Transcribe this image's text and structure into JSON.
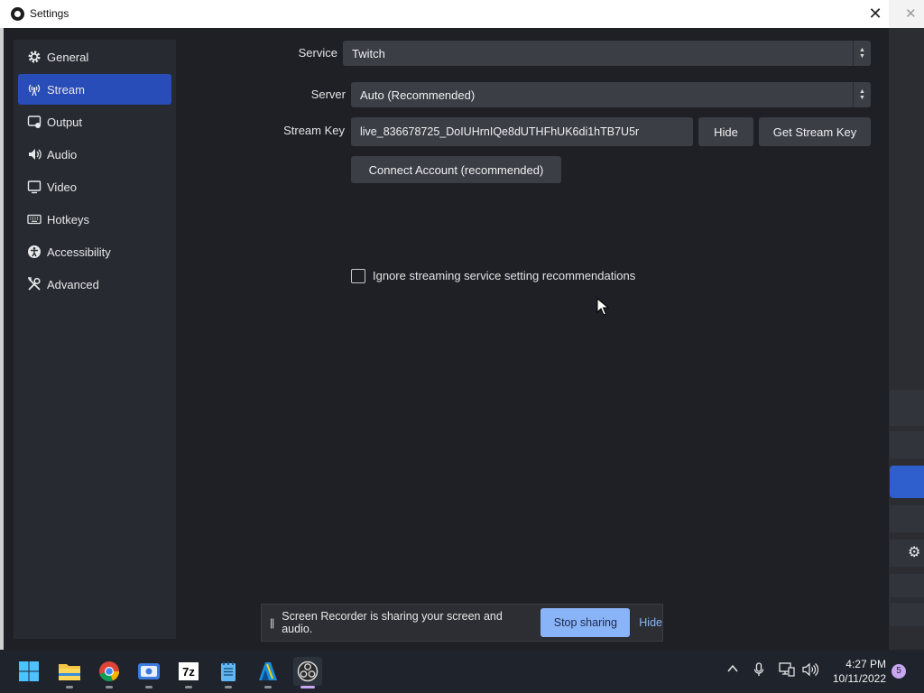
{
  "window": {
    "title": "Settings",
    "close_glyph": "✕"
  },
  "sidebar": {
    "items": [
      {
        "label": "General",
        "icon": "gear-icon",
        "active": false
      },
      {
        "label": "Stream",
        "icon": "antenna-icon",
        "active": true
      },
      {
        "label": "Output",
        "icon": "output-icon",
        "active": false
      },
      {
        "label": "Audio",
        "icon": "speaker-icon",
        "active": false
      },
      {
        "label": "Video",
        "icon": "monitor-icon",
        "active": false
      },
      {
        "label": "Hotkeys",
        "icon": "keyboard-icon",
        "active": false
      },
      {
        "label": "Accessibility",
        "icon": "accessibility-icon",
        "active": false
      },
      {
        "label": "Advanced",
        "icon": "tools-icon",
        "active": false
      }
    ]
  },
  "stream": {
    "service_label": "Service",
    "service_value": "Twitch",
    "server_label": "Server",
    "server_value": "Auto (Recommended)",
    "stream_key_label": "Stream Key",
    "stream_key_value": "live_836678725_DoIUHrnIQe8dUTHFhUK6di1hTB7U5r",
    "hide_button": "Hide",
    "get_key_button": "Get Stream Key",
    "connect_button": "Connect Account (recommended)",
    "ignore_checkbox_label": "Ignore streaming service setting recommendations",
    "ignore_checked": false
  },
  "share_bar": {
    "pause_glyph": "||",
    "message": "Screen Recorder is sharing your screen and audio.",
    "stop_button": "Stop sharing",
    "hide_link": "Hide"
  },
  "taskbar": {
    "apps": [
      {
        "name": "start-icon"
      },
      {
        "name": "file-explorer-icon"
      },
      {
        "name": "chrome-icon"
      },
      {
        "name": "screen-recorder-icon"
      },
      {
        "name": "7zip-icon",
        "text": "7z"
      },
      {
        "name": "notepad-icon"
      },
      {
        "name": "vlc-icon"
      },
      {
        "name": "obs-icon",
        "active": true
      }
    ],
    "time": "4:27 PM",
    "date": "10/11/2022",
    "notification_count": "5"
  },
  "colors": {
    "accent": "#284cb8",
    "share_button": "#8ab4f8",
    "background": "#1e2026"
  }
}
